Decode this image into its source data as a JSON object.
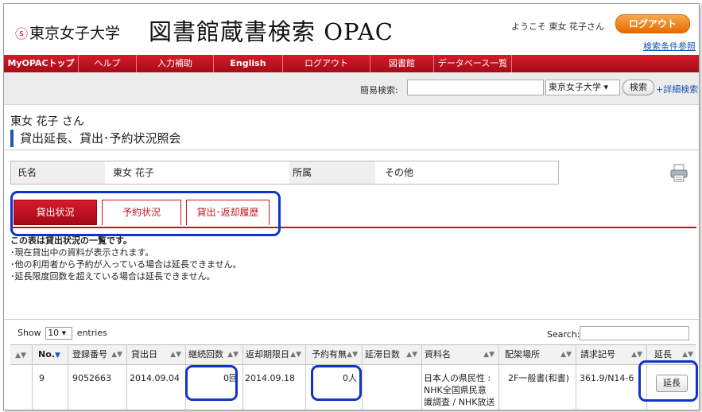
{
  "header": {
    "logo_mark": "ⓢ",
    "logo_text": "東京女子大学",
    "title": "図書館蔵書検索 OPAC",
    "welcome": "ようこそ 東女 花子さん",
    "logout": "ログアウト",
    "search_conditions": "検索条件参照"
  },
  "nav": [
    "MyOPACトップ",
    "ヘルプ",
    "入力補助",
    "English",
    "ログアウト",
    "図書館",
    "データベース一覧"
  ],
  "search": {
    "label": "簡易検索:",
    "scope": "東京女子大学 ▾",
    "button": "検索",
    "advanced": "+詳細検索"
  },
  "user": {
    "name": "東女 花子 さん"
  },
  "page_title": "貸出延長、貸出･予約状況照会",
  "info": {
    "name_label": "氏名",
    "name_value": "東女 花子",
    "affil_label": "所属",
    "affil_value": "その他"
  },
  "tabs": [
    "貸出状況",
    "予約状況",
    "貸出･返却履歴"
  ],
  "notes": [
    "この表は貸出状況の一覧です。",
    "･現在貸出中の資料が表示されます。",
    "･他の利用者から予約が入っている場合は延長できません。",
    "･延長限度回数を超えている場合は延長できません。"
  ],
  "table_controls": {
    "show": "Show",
    "entries_value": "10 ▾",
    "entries": "entries",
    "search_label": "Search:"
  },
  "columns": [
    "",
    "No.",
    "登録番号",
    "貸出日",
    "継続回数",
    "返却期限日",
    "予約有無",
    "延滞日数",
    "資料名",
    "配架場所",
    "請求記号",
    "延長"
  ],
  "row": {
    "no": "9",
    "reg_no": "9052663",
    "loan_date": "2014.09.04",
    "renewals": "0回",
    "due_date": "2014.09.18",
    "reservations": "0人",
    "overdue": "",
    "title_lines": [
      "日本人の県民性 :",
      "NHK全国県民意",
      "識調査 / NHK放送"
    ],
    "location": "2F一般書(和書)",
    "call_no": "361.9/N14-6",
    "extend_button": "延長"
  },
  "colors": {
    "accent_red": "#c4161c",
    "annotation_blue": "#1034c9",
    "title_bar_blue": "#1e5aa8"
  }
}
